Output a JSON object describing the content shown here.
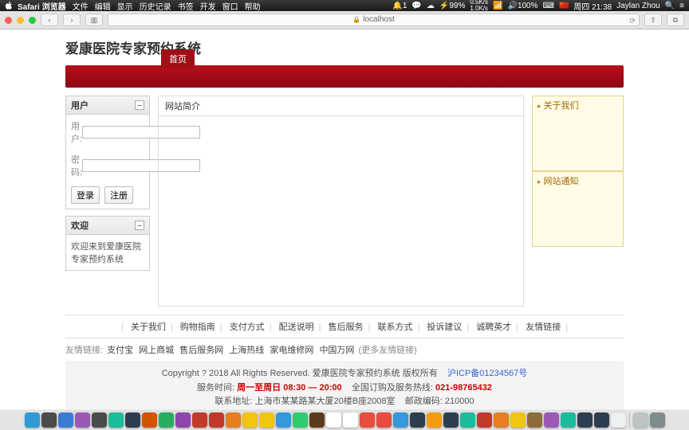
{
  "menubar": {
    "app": "Safari 浏览器",
    "items": [
      "文件",
      "编辑",
      "显示",
      "历史记录",
      "书签",
      "开发",
      "窗口",
      "帮助"
    ],
    "status": {
      "notif": "1",
      "battery": "99%",
      "net_up": "0.5K/s",
      "net_down": "1.0K/s",
      "vol": "100%",
      "date": "周四 21:38",
      "user": "Jaylan Zhou"
    }
  },
  "browser": {
    "url": "localhost"
  },
  "site": {
    "title": "爱康医院专家预约系统",
    "nav": {
      "home": "首页"
    }
  },
  "sidebar": {
    "user_panel": {
      "title": "用户",
      "username_label": "用户:",
      "password_label": "密码:",
      "username_value": "",
      "password_value": "",
      "login_btn": "登录",
      "register_btn": "注册"
    },
    "welcome_panel": {
      "title": "欢迎",
      "text": "欢迎来到爱康医院专家预约系统"
    }
  },
  "main": {
    "intro_title": "网站简介"
  },
  "rightside": {
    "about": "关于我们",
    "notice": "网站通知"
  },
  "footer": {
    "links": [
      "关于我们",
      "购物指南",
      "支付方式",
      "配送说明",
      "售后服务",
      "联系方式",
      "投诉建议",
      "诚聘英才",
      "友情链接"
    ],
    "friends_label": "友情链接:",
    "friends": [
      "支付宝",
      "网上商城",
      "售后服务网",
      "上海热线",
      "家电维修网",
      "中国万网"
    ],
    "friends_more": "(更多友情链接)",
    "copyright": "Copyright ? 2018 All Rights Reserved. 爱康医院专家预约系统 版权所有",
    "icp": "沪ICP备01234567号",
    "hours_label": "服务时间:",
    "hours": "周一至周日 08:30 — 20:00",
    "hotline_label": "全国订购及服务热线:",
    "hotline": "021-98765432",
    "address_label": "联系地址:",
    "address": "上海市某某路某大厦20楼B座2008室",
    "zip_label": "邮政编码:",
    "zip": "210000"
  },
  "dock": {
    "colors": [
      "#2e9bd6",
      "#4b4b4b",
      "#3a7bd5",
      "#9b59b6",
      "#4a4a4a",
      "#1abc9c",
      "#2c3e50",
      "#d35400",
      "#27ae60",
      "#8e44ad",
      "#c0392b",
      "#c0392b",
      "#e67e22",
      "#f1c40f",
      "#f1c40f",
      "#3498db",
      "#2ecc71",
      "#5a3c1a",
      "#fff",
      "#fff",
      "#e74c3c",
      "#e74c3c",
      "#3498db",
      "#2c3e50",
      "#f39c12",
      "#2c3e50",
      "#1abc9c",
      "#c0392b",
      "#e67e22",
      "#f1c40f",
      "#8f6b3a",
      "#9b59b6",
      "#1abc9c",
      "#2c3e50",
      "#2c3e50",
      "#ecf0f1",
      "#bdc3c7",
      "#7f8c8d"
    ]
  }
}
